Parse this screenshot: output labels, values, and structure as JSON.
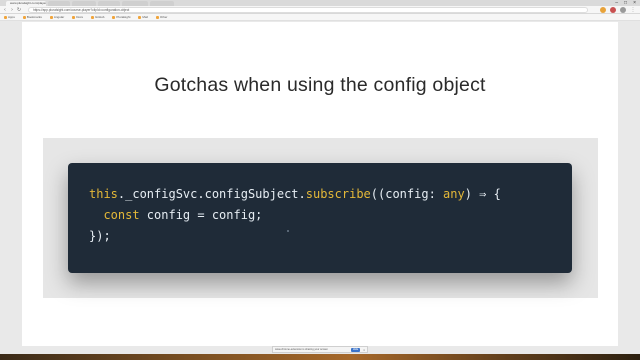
{
  "browser": {
    "tabs": [
      {
        "label": "www.pluralsight.com/player"
      },
      {
        "label": ""
      },
      {
        "label": ""
      },
      {
        "label": ""
      },
      {
        "label": ""
      },
      {
        "label": ""
      }
    ],
    "window_controls": [
      "–",
      "□",
      "×"
    ],
    "address": "https://app.pluralsight.com/course-player?clipId=configuration-object"
  },
  "bookmarks": [
    {
      "label": "Apps"
    },
    {
      "label": "Bookmarks"
    },
    {
      "label": "Angular"
    },
    {
      "label": "Docs"
    },
    {
      "label": "GitHub"
    },
    {
      "label": "Pluralsight"
    },
    {
      "label": "Mail"
    },
    {
      "label": "Other"
    }
  ],
  "slide": {
    "title": "Gotchas when using the config object",
    "code": {
      "line1": {
        "this": "this",
        "chain": "._configSvc.configSubject.",
        "subscribe": "subscribe",
        "open": "((config: ",
        "any": "any",
        "close": ") ⇒ {"
      },
      "line2": {
        "indent": "  ",
        "const": "const",
        "rest": " config = config;"
      },
      "line3": "});"
    }
  },
  "notification": {
    "text": "www.chrome-extension is sharing your screen",
    "button": "Hide",
    "close": "×"
  }
}
